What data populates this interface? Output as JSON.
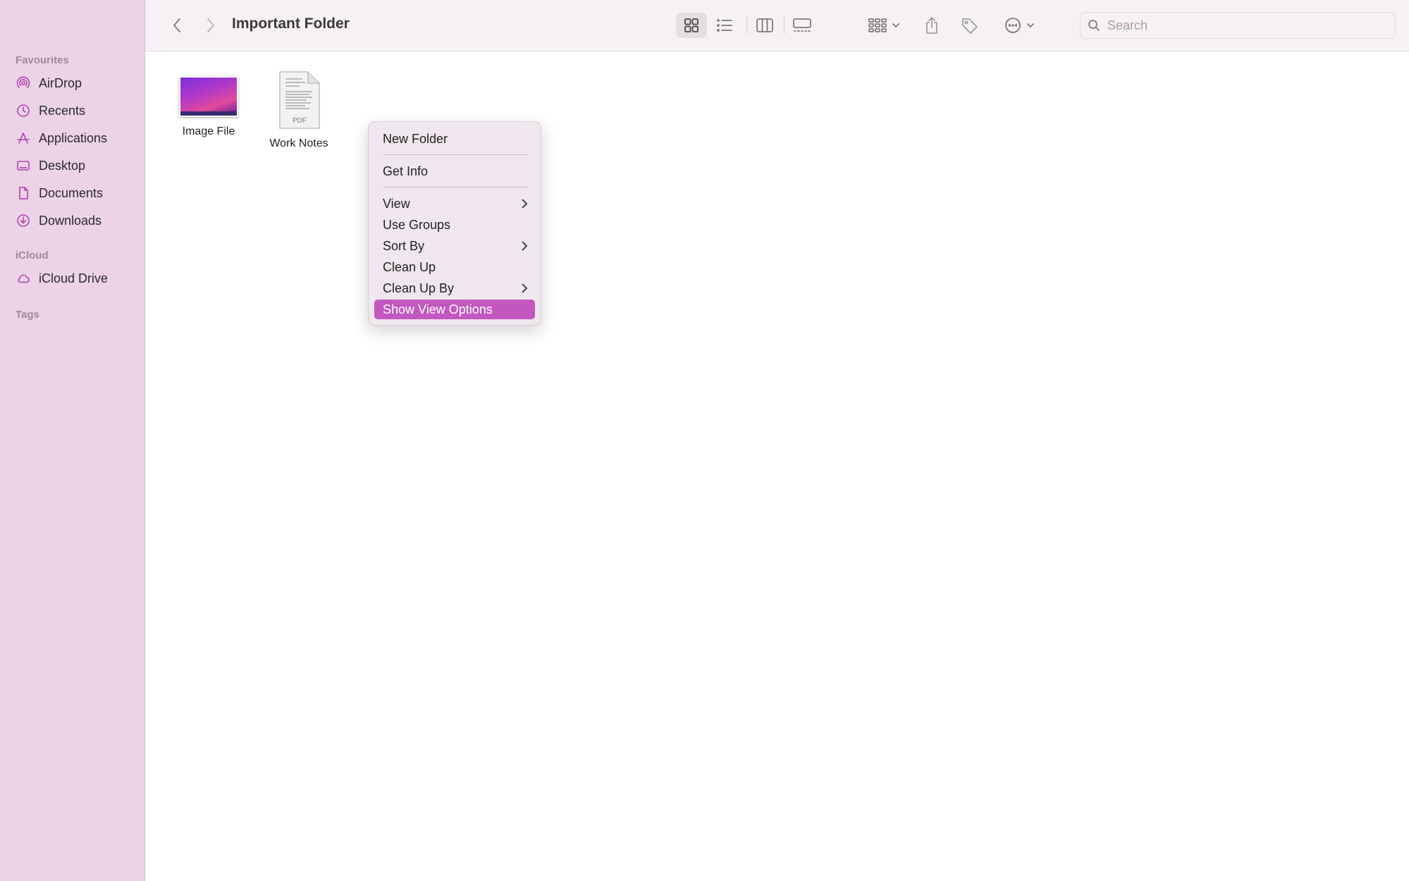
{
  "window": {
    "title": "Important Folder"
  },
  "sidebar": {
    "sections": {
      "favourites": "Favourites",
      "icloud": "iCloud",
      "tags": "Tags"
    },
    "favourites": [
      {
        "label": "AirDrop",
        "icon": "airdrop-icon"
      },
      {
        "label": "Recents",
        "icon": "clock-icon"
      },
      {
        "label": "Applications",
        "icon": "applications-icon"
      },
      {
        "label": "Desktop",
        "icon": "desktop-icon"
      },
      {
        "label": "Documents",
        "icon": "document-icon"
      },
      {
        "label": "Downloads",
        "icon": "download-icon"
      }
    ],
    "icloud": [
      {
        "label": "iCloud Drive",
        "icon": "cloud-icon"
      }
    ],
    "accent_color": "#b543b0"
  },
  "search": {
    "placeholder": "Search"
  },
  "files": [
    {
      "name": "Image File",
      "type": "image"
    },
    {
      "name": "Work Notes",
      "type": "pdf",
      "badge": "PDF"
    }
  ],
  "context_menu": {
    "new_folder": "New Folder",
    "get_info": "Get Info",
    "view": "View",
    "use_groups": "Use Groups",
    "sort_by": "Sort By",
    "clean_up": "Clean Up",
    "clean_up_by": "Clean Up By",
    "show_view_options": "Show View Options",
    "highlight_color": "#c258bf"
  }
}
